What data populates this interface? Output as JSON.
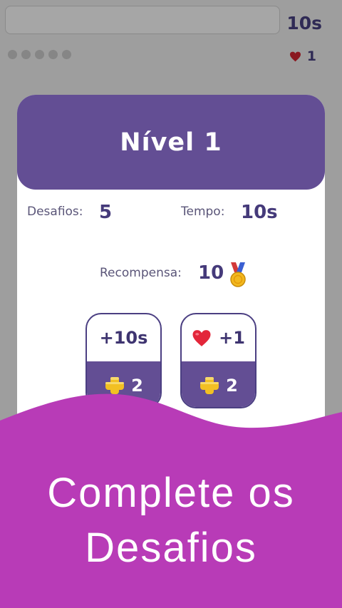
{
  "top": {
    "timer": "10s",
    "lives_count": "1"
  },
  "card": {
    "title": "Nível 1",
    "challenges_label": "Desafios:",
    "challenges_value": "5",
    "time_label": "Tempo:",
    "time_value": "10s",
    "reward_label": "Recompensa:",
    "reward_value": "10"
  },
  "powerups": [
    {
      "label": "+10s",
      "cost": "2"
    },
    {
      "label": "+1",
      "cost": "2"
    }
  ],
  "banner": {
    "line1": "Complete os",
    "line2": "Desafios"
  },
  "colors": {
    "overlay": "#9e9e9e",
    "header": "#634e94",
    "text_dark": "#453a7a",
    "banner": "#b83bb7",
    "heart": "#e3263a",
    "coin": "#f2c023",
    "medal_gold": "#f3b81e"
  }
}
